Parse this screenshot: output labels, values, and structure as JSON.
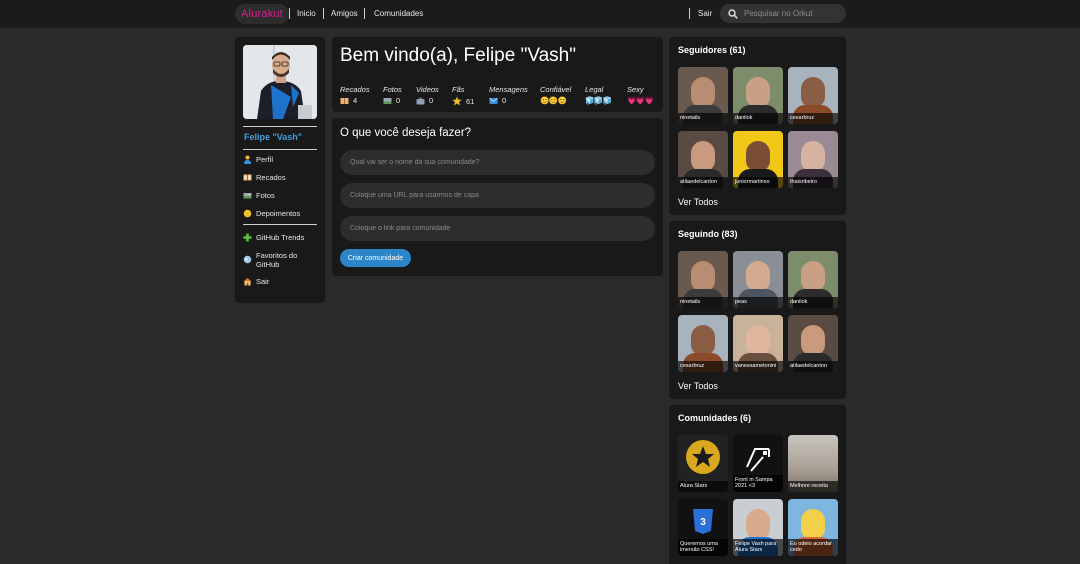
{
  "topbar": {
    "logo": "Alurakut",
    "nav": [
      "Inicio",
      "Amigos",
      "Comunidades"
    ],
    "logout": "Sair",
    "search_placeholder": "Pesquisar no Orkut"
  },
  "profile": {
    "name": "Felipe \"Vash\"",
    "menu": [
      {
        "label": "Perfil",
        "icon": "user-icon"
      },
      {
        "label": "Recados",
        "icon": "book-icon"
      },
      {
        "label": "Fotos",
        "icon": "camera-icon"
      },
      {
        "label": "Depoimentos",
        "icon": "sun-icon"
      },
      {
        "label": "GitHub Trends",
        "icon": "plus-icon"
      },
      {
        "label": "Favoritos do GitHub",
        "icon": "globe-icon"
      },
      {
        "label": "Sair",
        "icon": "home-icon"
      }
    ]
  },
  "welcome": {
    "title": "Bem vindo(a), Felipe \"Vash\"",
    "stats": [
      {
        "label": "Recados",
        "value": "4",
        "icon": "book-icon"
      },
      {
        "label": "Fotos",
        "value": "0",
        "icon": "camera-icon"
      },
      {
        "label": "Videos",
        "value": "0",
        "icon": "tv-icon"
      },
      {
        "label": "Fãs",
        "value": "61",
        "icon": "star-icon"
      },
      {
        "label": "Mensagens",
        "value": "0",
        "icon": "mail-icon"
      },
      {
        "label": "Confiável",
        "value": "😊😊😊",
        "icon": ""
      },
      {
        "label": "Legal",
        "value": "🧊🧊🧊",
        "icon": ""
      },
      {
        "label": "Sexy",
        "value": "💗💗💗",
        "icon": ""
      }
    ]
  },
  "form": {
    "title": "O que você deseja fazer?",
    "fields": [
      "Qual vai ser o nome da sua comunidade?",
      "Coloque uma URL para usarmos de capa",
      "Coloque o link para comunidade"
    ],
    "submit": "Criar comunidade"
  },
  "followers": {
    "title": "Seguidores (61)",
    "items": [
      "ninetails",
      "danilok",
      "cesarbruz",
      "atilaedelcanton",
      "juniormartinxo",
      "thaisribeiro"
    ],
    "see_all": "Ver Todos"
  },
  "following": {
    "title": "Seguindo (83)",
    "items": [
      "ninetails",
      "peas",
      "danilok",
      "cesarbruz",
      "vanessametonini",
      "atilaedelcanton"
    ],
    "see_all": "Ver Todos"
  },
  "communities": {
    "title": "Comunidades (6)",
    "items": [
      "Alura Stars",
      "Front in Sampa 2021 <3",
      "Melhore receita",
      "Queremos uma imersão CSS!",
      "Felipe Vash para Alura Stars",
      "Eu odeio acordar cedo"
    ]
  },
  "colors": {
    "accent": "#2b85c8",
    "name_link": "#3fa0dd",
    "logo": "#d6228c"
  }
}
